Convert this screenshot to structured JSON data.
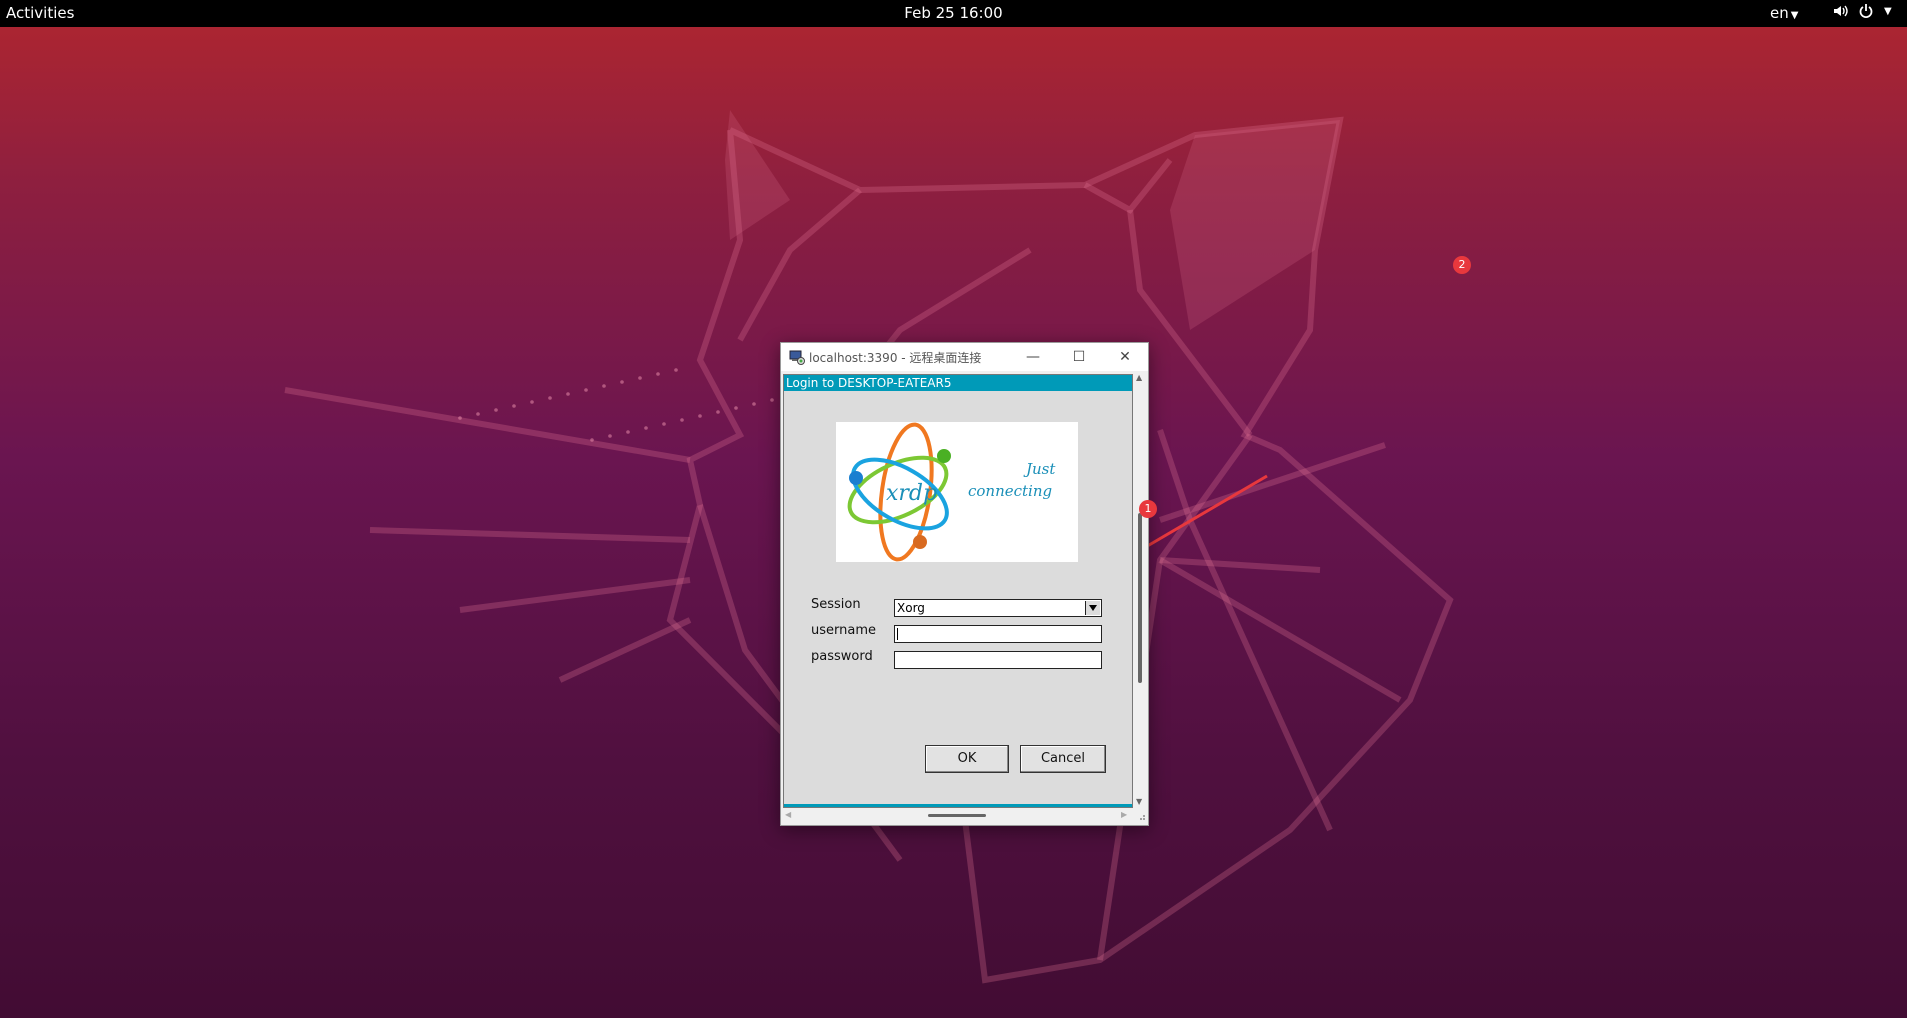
{
  "topbar": {
    "activities": "Activities",
    "clock": "Feb 25  16:00",
    "language": "en",
    "icons": [
      "volume-icon",
      "power-icon"
    ]
  },
  "annotations": {
    "badge1": "1",
    "badge2": "2",
    "color": "#e8383d"
  },
  "rdp_window": {
    "title": "localhost:3390 - 远程桌面连接",
    "controls": [
      "minimize",
      "maximize",
      "close"
    ],
    "login_header": "Login to DESKTOP-EATEAR5",
    "logo": {
      "text_main": "xrdp",
      "tagline_1": "Just",
      "tagline_2": "connecting"
    },
    "form": {
      "session_label": "Session",
      "session_value": "Xorg",
      "username_label": "username",
      "username_value": "",
      "password_label": "password",
      "password_value": ""
    },
    "buttons": {
      "ok": "OK",
      "cancel": "Cancel"
    }
  },
  "colors": {
    "xrdp_header": "#009ab8",
    "topbar": "#000000"
  }
}
